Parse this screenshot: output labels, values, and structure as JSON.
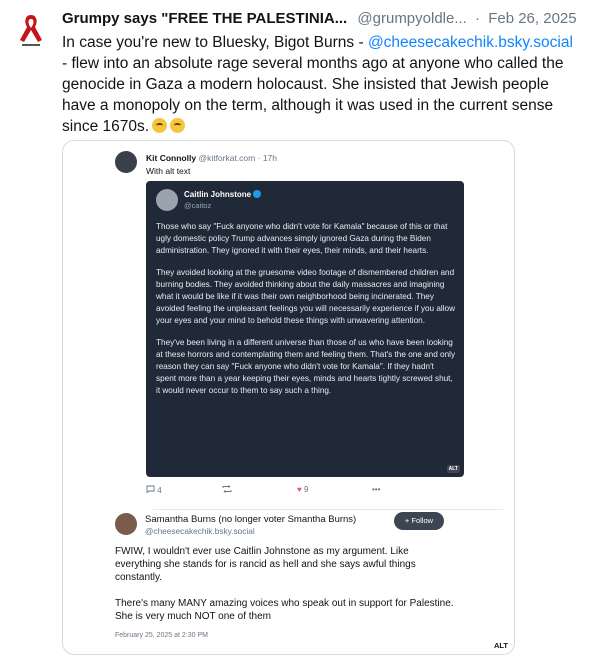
{
  "post": {
    "author_name": "Grumpy says \"FREE THE PALESTINIA...",
    "author_handle": "@grumpyoldle...",
    "separator": "·",
    "date": "Feb 26, 2025",
    "text_part1": "In case you're new to Bluesky, Bigot Burns - ",
    "mention": "@cheesecakechik.bsky.social",
    "text_part2": " - flew into an absolute rage several months ago at anyone who called the genocide in Gaza a modern holocaust. She insisted that Jewish people have a monopoly on the term, although it was used in the current sense since 1670s."
  },
  "embed": {
    "kit": {
      "name": "Kit Connolly",
      "handle": "@kitforkat.com",
      "time": "· 17h",
      "alt_caption": "With alt text"
    },
    "caitlin": {
      "name": "Caitlin Johnstone",
      "handle": "@caitoz",
      "p1": "Those who say \"Fuck anyone who didn't vote for Kamala\" because of this or that ugly domestic policy Trump advances simply ignored Gaza during the Biden administration. They ignored it with their eyes, their minds, and their hearts.",
      "p2": "They avoided looking at the gruesome video footage of dismembered children and burning bodies. They avoided thinking about the daily massacres and imagining what it would be like if it was their own neighborhood being incinerated. They avoided feeling the unpleasant feelings you will necessarily experience if you allow your eyes and your mind to behold these things with unwavering attention.",
      "p3": "They've been living in a different universe than those of us who have been looking at these horrors and contemplating them and feeling them. That's the one and only reason they can say \"Fuck anyone who didn't vote for Kamala\". If they hadn't spent more than a year keeping their eyes, minds and hearts tightly screwed shut, it would never occur to them to say such a thing.",
      "alt_badge": "ALT"
    },
    "actions": {
      "replies": "4",
      "likes": "9"
    },
    "samantha": {
      "name": "Samantha Burns (no longer voter Smantha Burns)",
      "handle": "@cheesecakechik.bsky.social",
      "follow_label": "+ Follow",
      "p1": "FWIW, I wouldn't ever use Caitlin Johnstone as my argument. Like everything she stands for is rancid as hell and she says awful things constantly.",
      "p2": "There's many MANY amazing voices who speak out in support for Palestine. She is very much NOT one of them",
      "date": "February 25, 2025 at 2:30 PM"
    },
    "alt_badge": "ALT"
  },
  "icons": {
    "reply": "comment-icon",
    "repost": "repost-icon",
    "like": "heart-icon",
    "more": "ellipsis-icon"
  },
  "colors": {
    "link": "#1083fe",
    "dark_card": "#1f2937",
    "heart": "#ec4899"
  }
}
